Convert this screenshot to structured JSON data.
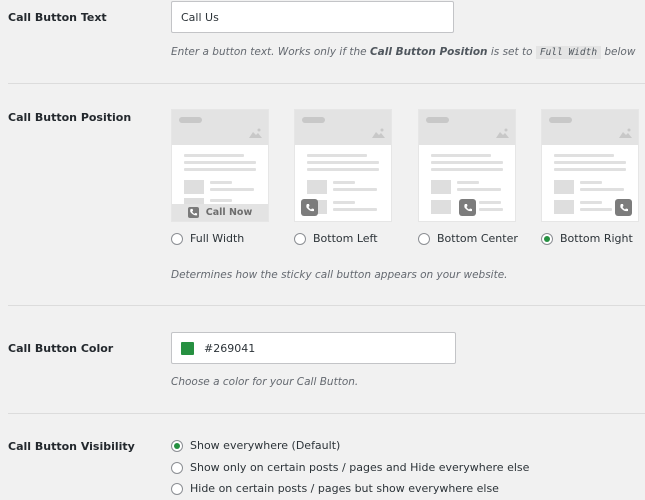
{
  "call_text": {
    "label": "Call Button Text",
    "value": "Call Us",
    "desc_prefix": "Enter a button text. Works only if the ",
    "desc_bold": "Call Button Position",
    "desc_mid": " is set to ",
    "desc_code": "Full Width",
    "desc_suffix": " below"
  },
  "position": {
    "label": "Call Button Position",
    "full_width_bar_label": "Call Now",
    "options": [
      "Full Width",
      "Bottom Left",
      "Bottom Center",
      "Bottom Right"
    ],
    "selected": "Bottom Right",
    "desc": "Determines how the sticky call button appears on your website."
  },
  "color": {
    "label": "Call Button Color",
    "value": "#269041",
    "swatch": "#269041",
    "desc": "Choose a color for your Call Button."
  },
  "visibility": {
    "label": "Call Button Visibility",
    "options": [
      "Show everywhere (Default)",
      "Show only on certain posts / pages and Hide everywhere else",
      "Hide on certain posts / pages but show everywhere else"
    ],
    "selected": "Show everywhere (Default)"
  },
  "icons": {
    "card_mountain": "image-icon",
    "phone": "phone-icon"
  },
  "colors": {
    "accent": "#269041"
  }
}
